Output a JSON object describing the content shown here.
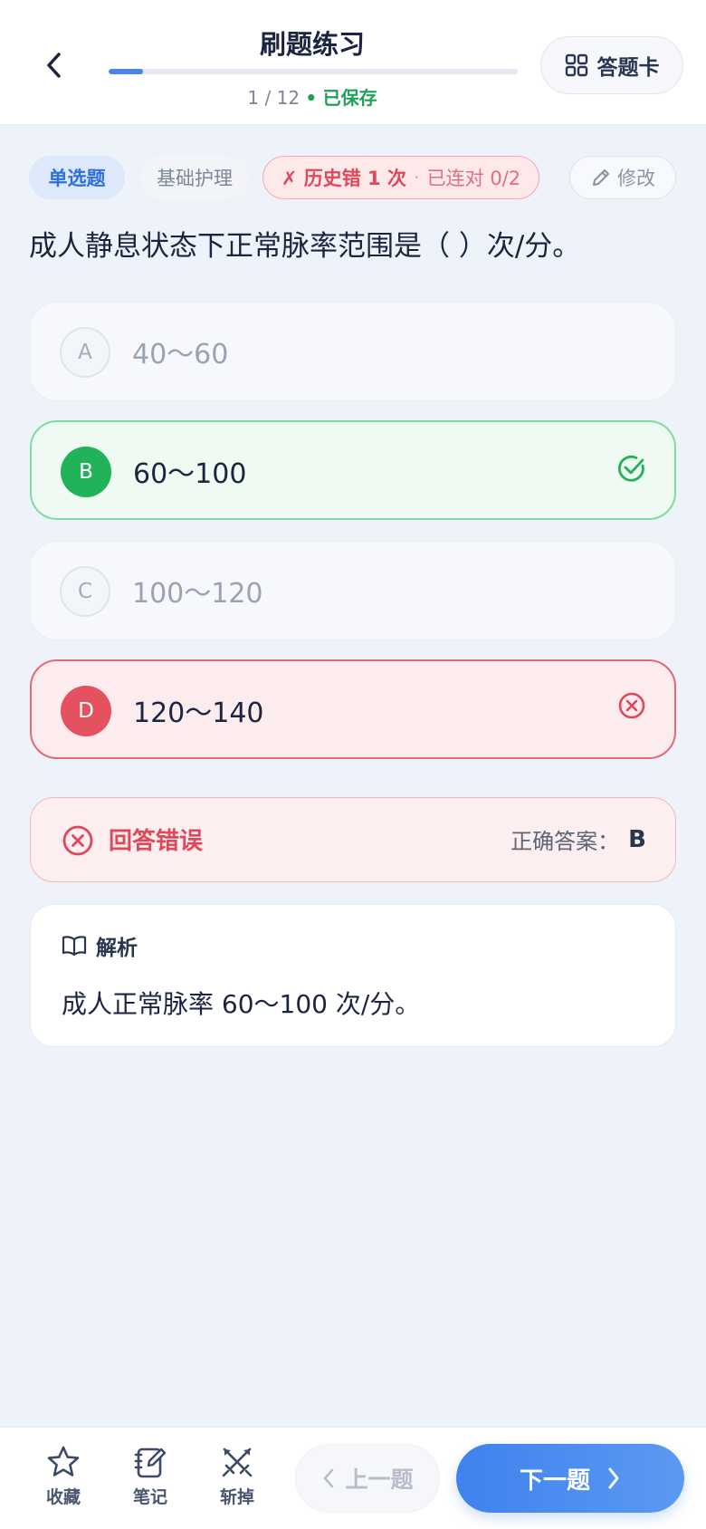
{
  "header": {
    "title": "刷题练习",
    "progress_current": 1,
    "progress_total": 12,
    "progress_text": "1 / 12",
    "progress_dot": "•",
    "saved_text": "已保存",
    "answer_card_label": "答题卡"
  },
  "tags": {
    "type": "单选题",
    "category": "基础护理",
    "history_wrong": "✗ 历史错 1 次",
    "separator": "·",
    "streak": "已连对 0/2",
    "edit_label": "修改"
  },
  "question": {
    "text": "成人静息状态下正常脉率范围是（ ）次/分。"
  },
  "options": [
    {
      "letter": "A",
      "text": "40～60",
      "state": "muted"
    },
    {
      "letter": "B",
      "text": "60～100",
      "state": "correct"
    },
    {
      "letter": "C",
      "text": "100～120",
      "state": "muted"
    },
    {
      "letter": "D",
      "text": "120～140",
      "state": "wrong"
    }
  ],
  "result": {
    "label": "回答错误",
    "answer_prefix": "正确答案：",
    "answer_value": "B"
  },
  "explanation": {
    "heading": "解析",
    "body": "成人正常脉率 60～100 次/分。"
  },
  "bottom": {
    "favorite_label": "收藏",
    "note_label": "笔记",
    "remove_label": "斩掉",
    "prev_label": "上一题",
    "next_label": "下一题"
  },
  "colors": {
    "accent": "#4a86ea",
    "correct": "#22b25a",
    "wrong": "#e0485a"
  }
}
